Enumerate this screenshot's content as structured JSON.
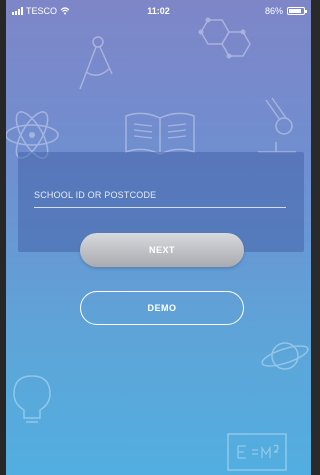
{
  "status_bar": {
    "carrier": "TESCO",
    "time": "11:02",
    "battery_percent": "86%",
    "battery_level": 0.86,
    "signal_icon": "signal-bars-icon",
    "wifi_icon": "wifi-icon",
    "battery_icon": "battery-icon"
  },
  "login": {
    "school_field_placeholder": "SCHOOL ID OR POSTCODE",
    "school_field_value": "",
    "next_label": "NEXT",
    "demo_label": "DEMO"
  },
  "background": {
    "doodle_icons": [
      "compass-icon",
      "molecule-icon",
      "atom-icon",
      "book-icon",
      "microscope-icon",
      "planet-icon",
      "lightbulb-icon",
      "formula-board-icon"
    ]
  },
  "colors": {
    "gradient_top": "#7e86c8",
    "gradient_bottom": "#52aee0",
    "next_button": "#bfc0c4",
    "card": "#4664aa"
  }
}
